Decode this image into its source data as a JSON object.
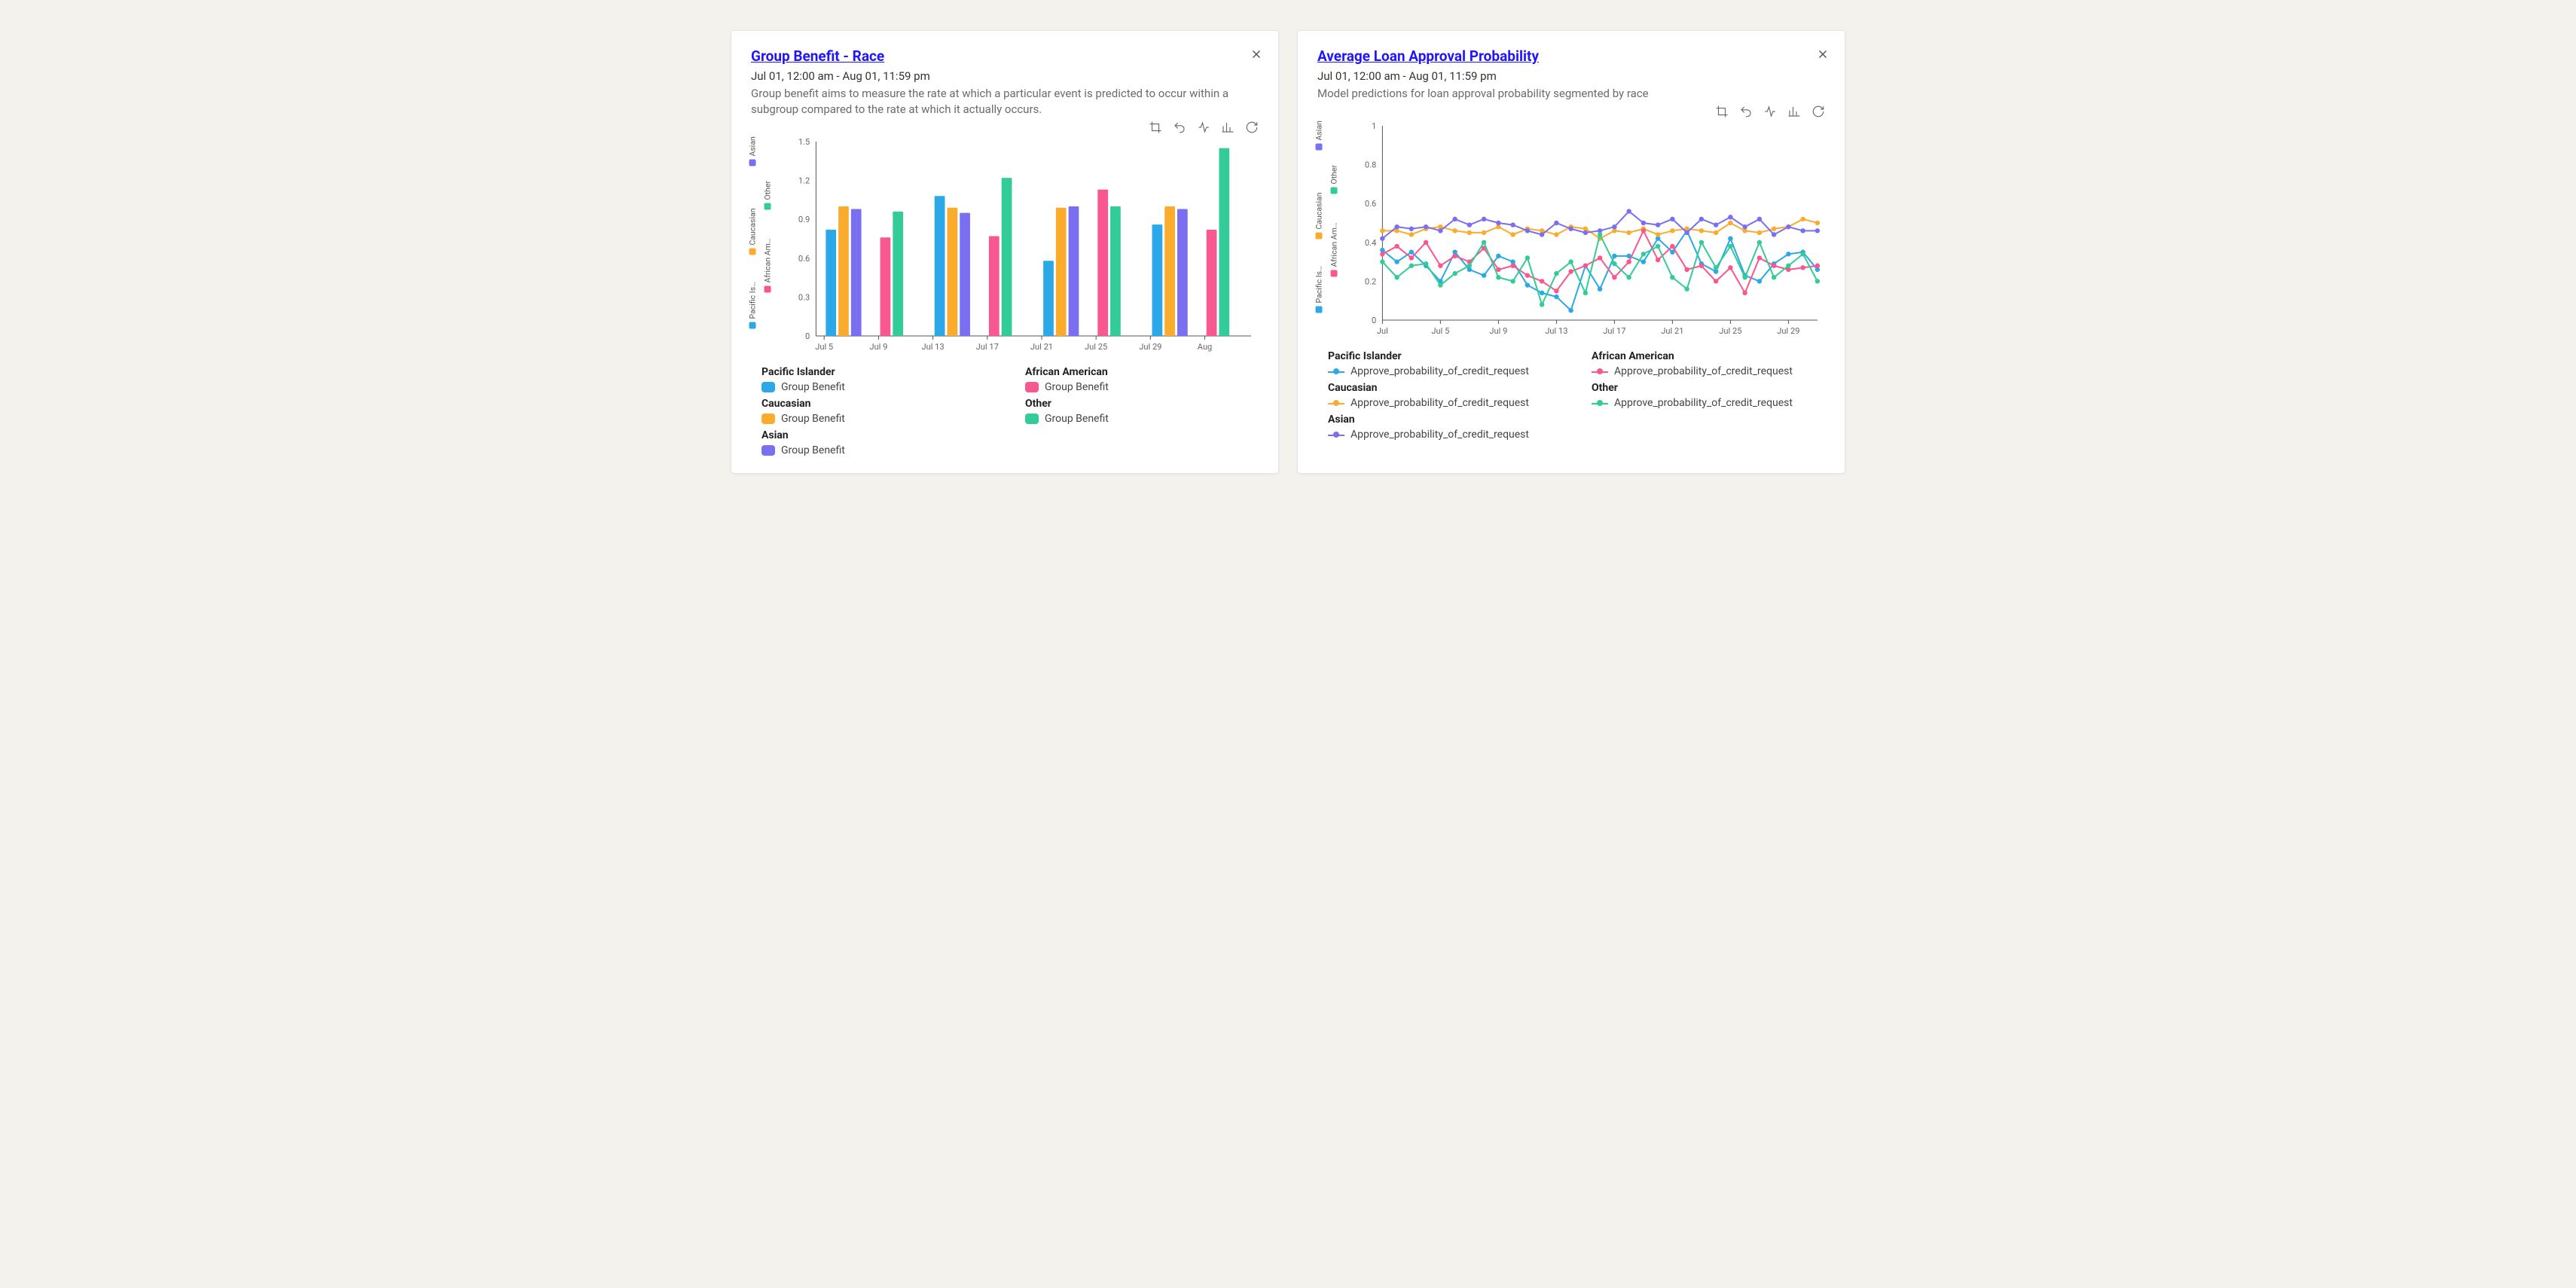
{
  "colors": {
    "pacific_islander": "#2aa8e8",
    "african_american": "#f9578f",
    "caucasian": "#fcac2d",
    "other": "#33cc99",
    "asian": "#7a6ff0"
  },
  "side_legend": [
    {
      "key": "pacific_islander",
      "label": "Pacific Is…"
    },
    {
      "key": "african_american",
      "label": "African Am…"
    },
    {
      "key": "caucasian",
      "label": "Caucasian"
    },
    {
      "key": "other",
      "label": "Other"
    },
    {
      "key": "asian",
      "label": "Asian"
    }
  ],
  "cards": [
    {
      "id": "group-benefit",
      "title": "Group Benefit - Race",
      "range": "Jul 01, 12:00 am - Aug 01, 11:59 pm",
      "desc": "Group benefit aims to measure the rate at which a particular event is predicted to occur within a subgroup compared to the rate at which it actually occurs.",
      "legend_metric": "Group Benefit",
      "legend_groups": [
        [
          "Pacific Islander",
          "pacific_islander"
        ],
        [
          "African American",
          "african_american"
        ],
        [
          "Caucasian",
          "caucasian"
        ],
        [
          "Other",
          "other"
        ],
        [
          "Asian",
          "asian"
        ]
      ]
    },
    {
      "id": "avg-approval",
      "title": "Average Loan Approval Probability",
      "range": "Jul 01, 12:00 am - Aug 01, 11:59 pm",
      "desc": "Model predictions for loan approval probability segmented by race",
      "legend_metric": "Approve_probability_of_credit_request",
      "legend_groups": [
        [
          "Pacific Islander",
          "pacific_islander"
        ],
        [
          "African American",
          "african_american"
        ],
        [
          "Caucasian",
          "caucasian"
        ],
        [
          "Other",
          "other"
        ],
        [
          "Asian",
          "asian"
        ]
      ]
    }
  ],
  "chart_data": [
    {
      "type": "bar",
      "title": "Group Benefit - Race",
      "xlabel": "",
      "ylabel": "",
      "ylim": [
        0,
        1.5
      ],
      "yticks": [
        0,
        0.3,
        0.6,
        0.9,
        1.2,
        1.5
      ],
      "x_ticks_shown": [
        "Jul 5",
        "Jul 9",
        "Jul 13",
        "Jul 17",
        "Jul 21",
        "Jul 25",
        "Jul 29",
        "Aug"
      ],
      "categories": [
        "Jul 5",
        "Jul 9",
        "Jul 13",
        "Jul 17",
        "Jul 21",
        "Jul 25",
        "Jul 29"
      ],
      "series": [
        {
          "name": "Pacific Islander",
          "key": "pacific_islander",
          "values": [
            0.82,
            null,
            1.08,
            null,
            0.58,
            null,
            0.86
          ]
        },
        {
          "name": "Caucasian",
          "key": "caucasian",
          "values": [
            1.0,
            null,
            0.99,
            null,
            0.99,
            null,
            1.0
          ]
        },
        {
          "name": "Asian",
          "key": "asian",
          "values": [
            0.98,
            null,
            0.95,
            null,
            1.0,
            null,
            0.98
          ]
        },
        {
          "name": "African American",
          "key": "african_american",
          "values": [
            null,
            0.76,
            null,
            0.77,
            null,
            1.13,
            null,
            0.82
          ]
        },
        {
          "name": "Other",
          "key": "other",
          "values": [
            null,
            0.96,
            null,
            1.22,
            null,
            1.0,
            null,
            1.45
          ]
        }
      ]
    },
    {
      "type": "line",
      "title": "Average Loan Approval Probability",
      "xlabel": "",
      "ylabel": "",
      "ylim": [
        0,
        1
      ],
      "yticks": [
        0,
        0.2,
        0.4,
        0.6,
        0.8,
        1
      ],
      "x_ticks_shown": [
        "Jul",
        "Jul 5",
        "Jul 9",
        "Jul 13",
        "Jul 17",
        "Jul 21",
        "Jul 25",
        "Jul 29"
      ],
      "x": [
        1,
        2,
        3,
        4,
        5,
        6,
        7,
        8,
        9,
        10,
        11,
        12,
        13,
        14,
        15,
        16,
        17,
        18,
        19,
        20,
        21,
        22,
        23,
        24,
        25,
        26,
        27,
        28,
        29,
        30,
        31
      ],
      "series": [
        {
          "name": "Pacific Islander",
          "key": "pacific_islander",
          "values": [
            0.36,
            0.3,
            0.35,
            0.28,
            0.2,
            0.35,
            0.26,
            0.23,
            0.33,
            0.3,
            0.18,
            0.14,
            0.12,
            0.05,
            0.28,
            0.16,
            0.33,
            0.33,
            0.3,
            0.42,
            0.35,
            0.46,
            0.29,
            0.25,
            0.42,
            0.23,
            0.2,
            0.29,
            0.34,
            0.35,
            0.26
          ]
        },
        {
          "name": "Caucasian",
          "key": "caucasian",
          "values": [
            0.46,
            0.46,
            0.44,
            0.47,
            0.48,
            0.46,
            0.45,
            0.45,
            0.48,
            0.44,
            0.47,
            0.46,
            0.44,
            0.48,
            0.47,
            0.42,
            0.46,
            0.45,
            0.47,
            0.44,
            0.46,
            0.47,
            0.46,
            0.45,
            0.5,
            0.46,
            0.45,
            0.47,
            0.48,
            0.52,
            0.5
          ]
        },
        {
          "name": "Asian",
          "key": "asian",
          "values": [
            0.42,
            0.48,
            0.47,
            0.48,
            0.46,
            0.52,
            0.49,
            0.52,
            0.5,
            0.49,
            0.46,
            0.44,
            0.5,
            0.47,
            0.45,
            0.46,
            0.48,
            0.56,
            0.5,
            0.49,
            0.52,
            0.45,
            0.52,
            0.49,
            0.53,
            0.48,
            0.52,
            0.44,
            0.48,
            0.46,
            0.46
          ]
        },
        {
          "name": "African American",
          "key": "african_american",
          "values": [
            0.34,
            0.38,
            0.32,
            0.4,
            0.28,
            0.33,
            0.3,
            0.37,
            0.26,
            0.28,
            0.23,
            0.2,
            0.15,
            0.25,
            0.28,
            0.32,
            0.22,
            0.3,
            0.46,
            0.31,
            0.38,
            0.26,
            0.28,
            0.2,
            0.27,
            0.14,
            0.32,
            0.28,
            0.26,
            0.27,
            0.28
          ]
        },
        {
          "name": "Other",
          "key": "other",
          "values": [
            0.3,
            0.22,
            0.28,
            0.29,
            0.18,
            0.24,
            0.28,
            0.4,
            0.22,
            0.2,
            0.32,
            0.08,
            0.24,
            0.3,
            0.14,
            0.44,
            0.29,
            0.22,
            0.34,
            0.38,
            0.22,
            0.16,
            0.4,
            0.27,
            0.38,
            0.22,
            0.4,
            0.22,
            0.28,
            0.34,
            0.2
          ]
        }
      ]
    }
  ]
}
